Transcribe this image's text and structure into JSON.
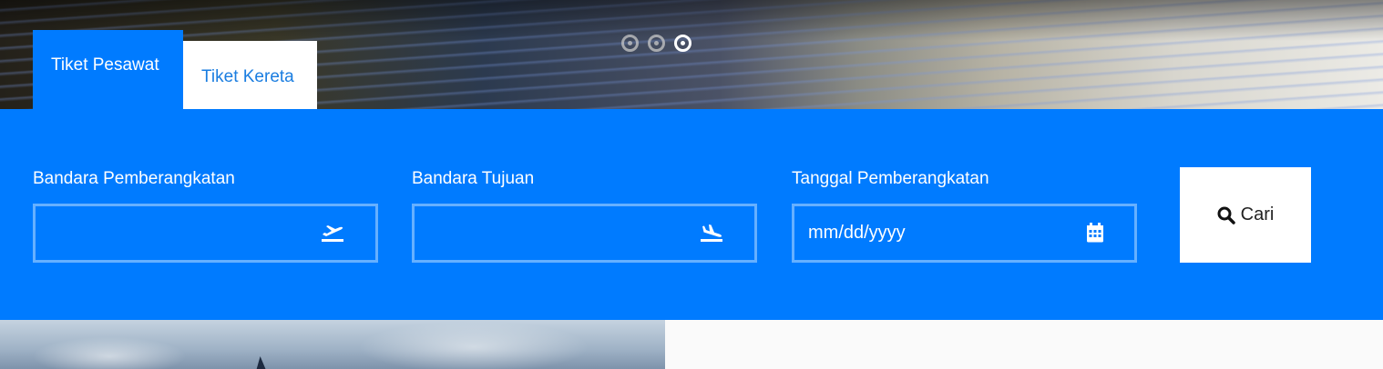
{
  "carousel": {
    "slides": 3,
    "active_index": 2
  },
  "tabs": [
    {
      "label": "Tiket Pesawat",
      "active": true
    },
    {
      "label": "Tiket Kereta",
      "active": false
    }
  ],
  "search": {
    "departure": {
      "label": "Bandara Pemberangkatan",
      "value": "",
      "icon": "plane-departure-icon"
    },
    "destination": {
      "label": "Bandara Tujuan",
      "value": "",
      "icon": "plane-arrival-icon"
    },
    "date": {
      "label": "Tanggal Pemberangkatan",
      "placeholder": "mm/dd/yyyy",
      "icon": "calendar-icon"
    },
    "button": {
      "label": "Cari",
      "icon": "search-icon"
    }
  },
  "colors": {
    "primary": "#007bff",
    "input_border": "#66b0ff",
    "tab_text": "#1a7de0"
  }
}
